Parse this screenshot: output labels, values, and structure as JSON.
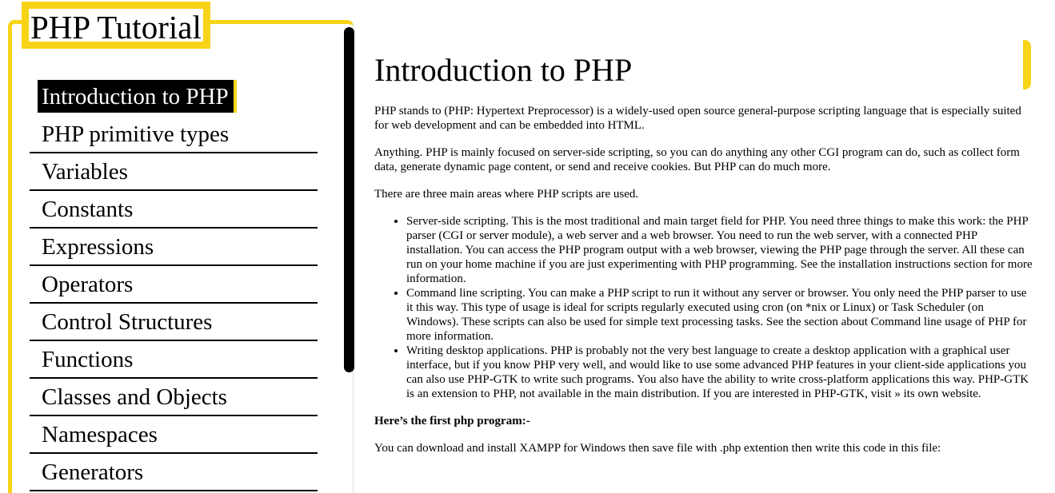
{
  "sidebar": {
    "title": "PHP Tutorial",
    "items": [
      {
        "label": "Introduction to PHP",
        "active": true
      },
      {
        "label": "PHP primitive types"
      },
      {
        "label": "Variables"
      },
      {
        "label": "Constants"
      },
      {
        "label": "Expressions"
      },
      {
        "label": "Operators"
      },
      {
        "label": "Control Structures"
      },
      {
        "label": "Functions"
      },
      {
        "label": "Classes and Objects"
      },
      {
        "label": "Namespaces"
      },
      {
        "label": "Generators"
      }
    ]
  },
  "main": {
    "heading": "Introduction to PHP",
    "paragraphs": [
      "PHP stands to (PHP: Hypertext Preprocessor) is a widely-used open source general-purpose scripting language that is especially suited for web development and can be embedded into HTML.",
      "Anything. PHP is mainly focused on server-side scripting, so you can do anything any other CGI program can do, such as collect form data, generate dynamic page content, or send and receive cookies. But PHP can do much more.",
      "There are three main areas where PHP scripts are used."
    ],
    "bullets": [
      "Server-side scripting. This is the most traditional and main target field for PHP. You need three things to make this work: the PHP parser (CGI or server module), a web server and a web browser. You need to run the web server, with a connected PHP installation. You can access the PHP program output with a web browser, viewing the PHP page through the server. All these can run on your home machine if you are just experimenting with PHP programming. See the installation instructions section for more information.",
      "Command line scripting. You can make a PHP script to run it without any server or browser. You only need the PHP parser to use it this way. This type of usage is ideal for scripts regularly executed using cron (on *nix or Linux) or Task Scheduler (on Windows). These scripts can also be used for simple text processing tasks. See the section about Command line usage of PHP for more information.",
      "Writing desktop applications. PHP is probably not the very best language to create a desktop application with a graphical user interface, but if you know PHP very well, and would like to use some advanced PHP features in your client-side applications you can also use PHP-GTK to write such programs. You also have the ability to write cross-platform applications this way. PHP-GTK is an extension to PHP, not available in the main distribution. If you are interested in PHP-GTK, visit » its own website."
    ],
    "first_program_heading": "Here’s the first php program:-",
    "download_text": "You can download and install XAMPP for Windows then save file with .php extention then write this code in this file:"
  },
  "colors": {
    "accent": "#f7d417",
    "text": "#000000",
    "background": "#ffffff"
  }
}
